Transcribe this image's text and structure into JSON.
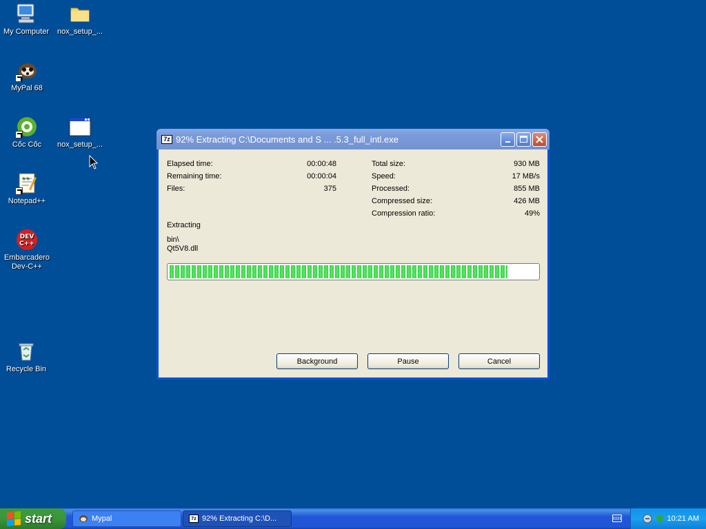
{
  "desktop": {
    "icons": [
      {
        "label": "My Computer",
        "icon": "my-computer-icon"
      },
      {
        "label": "nox_setup_...",
        "icon": "folder-icon"
      },
      {
        "label": "MyPal 68",
        "icon": "mypal-icon"
      },
      {
        "label": "Cốc Cốc",
        "icon": "coccoc-icon"
      },
      {
        "label": "nox_setup_...",
        "icon": "window-app-icon"
      },
      {
        "label": "Notepad++",
        "icon": "notepadpp-icon"
      },
      {
        "label": "Embarcadero Dev-C++",
        "icon": "devcpp-icon"
      },
      {
        "label": "Recycle Bin",
        "icon": "recycle-bin-icon"
      }
    ]
  },
  "dialog": {
    "title_icon": "7z",
    "title": "92% Extracting C:\\Documents and S ... .5.3_full_intl.exe",
    "left_stats": [
      {
        "label": "Elapsed time:",
        "value": "00:00:48"
      },
      {
        "label": "Remaining time:",
        "value": "00:00:04"
      },
      {
        "label": "Files:",
        "value": "375"
      }
    ],
    "right_stats": [
      {
        "label": "Total size:",
        "value": "930 MB"
      },
      {
        "label": "Speed:",
        "value": "17 MB/s"
      },
      {
        "label": "Processed:",
        "value": "855 MB"
      },
      {
        "label": "Compressed size:",
        "value": "426 MB"
      },
      {
        "label": "Compression ratio:",
        "value": "49%"
      }
    ],
    "status_label": "Extracting",
    "current_folder": "bin\\",
    "current_file": "Qt5V8.dll",
    "progress_percent": 92,
    "buttons": {
      "background": "Background",
      "pause": "Pause",
      "cancel": "Cancel"
    }
  },
  "taskbar": {
    "start_label": "start",
    "tasks": [
      {
        "label": "Mypal",
        "active": false
      },
      {
        "label": "92% Extracting C:\\D...",
        "active": true
      }
    ],
    "clock": "10:21 AM"
  }
}
